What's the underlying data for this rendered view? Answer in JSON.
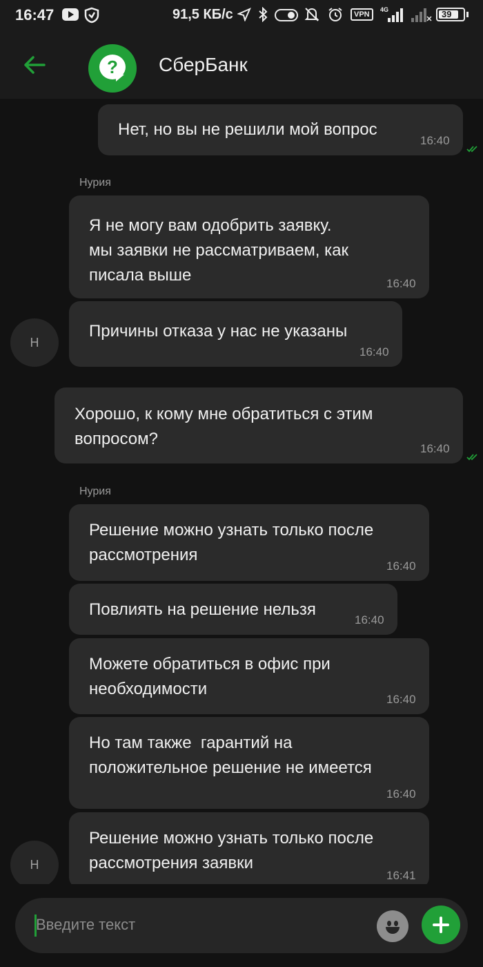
{
  "status_bar": {
    "time": "16:47",
    "speed": "91,5 КБ/с",
    "vpn": "VPN",
    "network": "4G",
    "battery": "39",
    "icons": [
      "youtube-icon",
      "shield-icon",
      "location-icon",
      "bluetooth-icon",
      "toggle-icon",
      "mute-icon",
      "alarm-icon",
      "signal-icon",
      "signal-icon-2"
    ]
  },
  "header": {
    "title": "СберБанк",
    "logo_glyph": "?"
  },
  "messages": [
    {
      "direction": "out",
      "text": "Нет, но вы не решили мой вопрос",
      "time": "16:40",
      "read": true
    },
    {
      "direction": "in",
      "sender": "Нурия",
      "text": "Я не могу вам одобрить заявку.\nмы заявки не рассматриваем, как\nписала выше",
      "time": "16:40"
    },
    {
      "direction": "in",
      "text": "Причины отказа у нас не указаны",
      "time": "16:40",
      "avatar": "Н"
    },
    {
      "direction": "out",
      "text": "Хорошо, к кому мне обратиться с этим\nвопросом?",
      "time": "16:40",
      "read": true
    },
    {
      "direction": "in",
      "sender": "Нурия",
      "text": "Решение можно узнать только после\nрассмотрения",
      "time": "16:40"
    },
    {
      "direction": "in",
      "text": "Повлиять на решение нельзя",
      "time": "16:40"
    },
    {
      "direction": "in",
      "text": "Можете обратиться в офис при\nнеобходимости",
      "time": "16:40"
    },
    {
      "direction": "in",
      "text": "Но там также  гарантий на\nположительное решение не имеется",
      "time": "16:40"
    },
    {
      "direction": "in",
      "text": "Решение можно узнать только после\nрассмотрения заявки",
      "time": "16:41",
      "avatar": "Н"
    }
  ],
  "input": {
    "placeholder": "Введите текст"
  },
  "colors": {
    "accent": "#21a038",
    "background": "#121212",
    "bubble": "#2b2b2b",
    "header": "#1b1b1b"
  }
}
